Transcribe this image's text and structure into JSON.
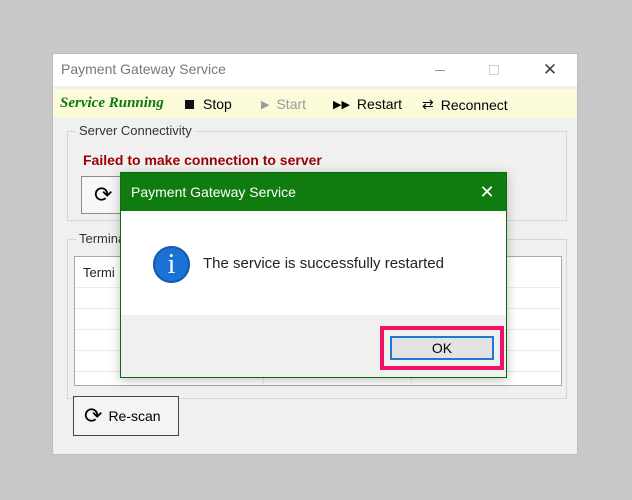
{
  "window": {
    "title": "Payment Gateway Service",
    "min_glyph": "—",
    "max_glyph": "☐",
    "close_glyph": "✕"
  },
  "toolbar": {
    "status": "Service Running",
    "stop_label": "Stop",
    "start_label": "Start",
    "restart_label": "Restart",
    "reconnect_label": "Reconnect",
    "start_icon": "▶",
    "restart_icon": "▶▶",
    "reconnect_icon": "⇄"
  },
  "connectivity": {
    "group_label": "Server Connectivity",
    "error_text": "Failed to make connection to server",
    "refresh_icon": "⟳"
  },
  "terminals": {
    "group_label": "Termina",
    "column_header": "Termi",
    "rescan_label": "Re-scan",
    "rescan_icon": "⟳"
  },
  "dialog": {
    "title": "Payment Gateway Service",
    "close_glyph": "✕",
    "icon": "i",
    "message": "The service is successfully restarted",
    "ok_label": "OK"
  },
  "colors": {
    "dialog_title_bg": "#107c10",
    "status_text": "#0b7a0b",
    "error_text": "#9b0000",
    "highlight": "#ee1164",
    "info_icon": "#1a73d4"
  }
}
